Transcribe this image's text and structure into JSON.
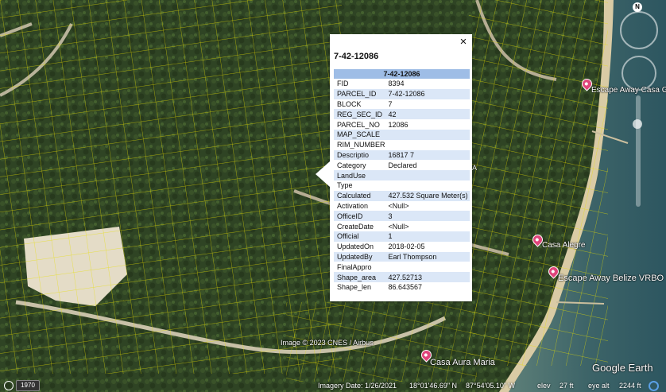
{
  "popup": {
    "close_label": "×",
    "title": "7-42-12086",
    "table_header": "7-42-12086",
    "rows": [
      {
        "key": "FID",
        "value": "8394"
      },
      {
        "key": "PARCEL_ID",
        "value": "7-42-12086"
      },
      {
        "key": "BLOCK",
        "value": "7"
      },
      {
        "key": "REG_SEC_ID",
        "value": "42"
      },
      {
        "key": "PARCEL_NO",
        "value": "12086"
      },
      {
        "key": "MAP_SCALE",
        "value": ""
      },
      {
        "key": "RIM_NUMBER",
        "value": ""
      },
      {
        "key": "Descriptio",
        "value": "16817 7"
      },
      {
        "key": "Category",
        "value": "Declared"
      },
      {
        "key": "LandUse",
        "value": ""
      },
      {
        "key": "Type",
        "value": ""
      },
      {
        "key": "Calculated",
        "value": "427.532 Square Meter(s)"
      },
      {
        "key": "Activation",
        "value": "<Null>"
      },
      {
        "key": "OfficeID",
        "value": "3"
      },
      {
        "key": "CreateDate",
        "value": "<Null>"
      },
      {
        "key": "Official",
        "value": "1"
      },
      {
        "key": "UpdatedOn",
        "value": "2018-02-05"
      },
      {
        "key": "UpdatedBy",
        "value": "Earl Thompson"
      },
      {
        "key": "FinalAppro",
        "value": ""
      },
      {
        "key": "Shape_area",
        "value": "427.52713"
      },
      {
        "key": "Shape_len",
        "value": "86.643567"
      }
    ]
  },
  "places": [
    {
      "name": "Escape Away Casa Gra"
    },
    {
      "name": "Casa Alegre"
    },
    {
      "name": "Escape Away Belize VRBO"
    },
    {
      "name": "Casa Aura Maria"
    }
  ],
  "stray_label": "A",
  "attribution": "Image © 2023 CNES / Airbus",
  "logo": "Google Earth",
  "compass": "N",
  "status": {
    "year": "1970",
    "imagery_date": "Imagery Date: 1/26/2021",
    "lat": "18°01'46.69\" N",
    "lon": "87°54'05.10\" W",
    "elev_label": "elev",
    "elev_value": "27 ft",
    "eye_alt_label": "eye alt",
    "eye_alt_value": "2244 ft"
  },
  "colors": {
    "parcel_lines": "#e8e000",
    "popup_header": "#9ebde6",
    "row_alt": "#dbe7f7",
    "pin": "#e0457b"
  }
}
